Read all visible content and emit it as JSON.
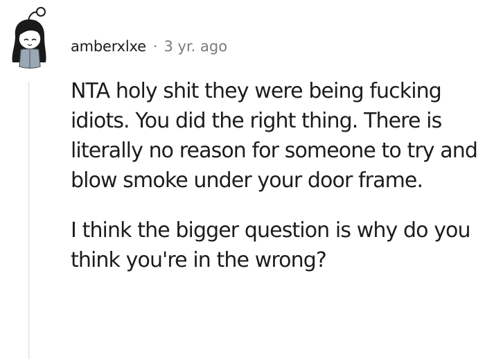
{
  "comment": {
    "author": "amberxlxe",
    "separator": "·",
    "timestamp": "3 yr. ago",
    "avatar_icon": "snoo-avatar-icon",
    "paragraphs": [
      "NTA holy shit they were being fucking idiots. You did the right thing. There is literally no reason for someone to try and blow smoke under your door frame.",
      "I think the bigger question is why do you think you're in the wrong?"
    ]
  },
  "colors": {
    "text": "#1c1c1c",
    "meta": "#787c7e",
    "thread_line": "#edeff1",
    "avatar_hair": "#1a1a1a",
    "avatar_shirt": "#9aa7b4"
  }
}
